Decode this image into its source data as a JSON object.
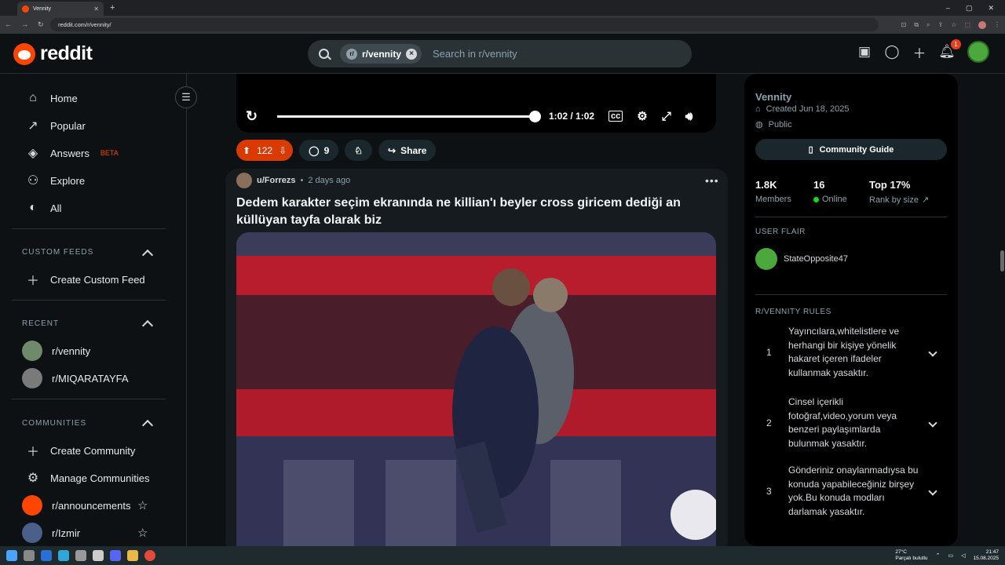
{
  "browser": {
    "tab_title": "Vennity",
    "url": "reddit.com/r/vennity/"
  },
  "header": {
    "logo_text": "reddit",
    "search_chip": "r/vennity",
    "search_placeholder": "Search in r/vennity",
    "notification_count": "1"
  },
  "sidebar": {
    "nav": [
      {
        "label": "Home",
        "icon": "home-icon"
      },
      {
        "label": "Popular",
        "icon": "popular-icon"
      },
      {
        "label": "Answers",
        "icon": "answers-icon",
        "badge": "BETA"
      },
      {
        "label": "Explore",
        "icon": "explore-icon"
      },
      {
        "label": "All",
        "icon": "all-icon"
      }
    ],
    "custom_feeds_title": "CUSTOM FEEDS",
    "create_custom_feed": "Create Custom Feed",
    "recent_title": "RECENT",
    "recent": [
      "r/vennity",
      "r/MIQARATAYFA"
    ],
    "communities_title": "COMMUNITIES",
    "create_community": "Create Community",
    "manage_communities": "Manage Communities",
    "communities": [
      "r/announcements",
      "r/Izmir"
    ]
  },
  "prev_post": {
    "video_time": "1:02 / 1:02",
    "video_progress": 1.0,
    "upvotes": "122",
    "comments": "9",
    "share_label": "Share"
  },
  "post": {
    "author": "u/Forrezs",
    "time": "2 days ago",
    "title": "Dedem karakter seçim ekranında ne killian'ı beyler cross giricem dediği an küllüyan tayfa olarak biz"
  },
  "right": {
    "community_name": "Vennity",
    "created": "Created Jun 18, 2025",
    "visibility": "Public",
    "guide_label": "Community Guide",
    "stats": [
      {
        "value": "1.8K",
        "label": "Members"
      },
      {
        "value": "16",
        "label": "Online"
      },
      {
        "value": "Top 17%",
        "label": "Rank by size"
      }
    ],
    "user_flair_title": "USER FLAIR",
    "flair_name": "StateOpposite47",
    "rules_title": "R/VENNITY RULES",
    "rules": [
      {
        "num": "1",
        "text": "Yayıncılara,whitelistlere ve herhangi bir kişiye yönelik hakaret içeren ifadeler kullanmak yasaktır."
      },
      {
        "num": "2",
        "text": "Cinsel içerikli fotoğraf,video,yorum veya benzeri paylaşımlarda bulunmak yasaktır."
      },
      {
        "num": "3",
        "text": "Gönderiniz onaylanmadıysa bu konuda yapabileceğiniz birşey yok.Bu konuda modları darlamak yasaktır."
      }
    ]
  },
  "taskbar": {
    "temp": "27°C",
    "weather": "Parçalı bulutlu",
    "time": "21:47",
    "date": "15.08.2025"
  },
  "colors": {
    "accent": "#ff4500",
    "upvote_bg": "#d93a00",
    "online_dot": "#02e114"
  }
}
